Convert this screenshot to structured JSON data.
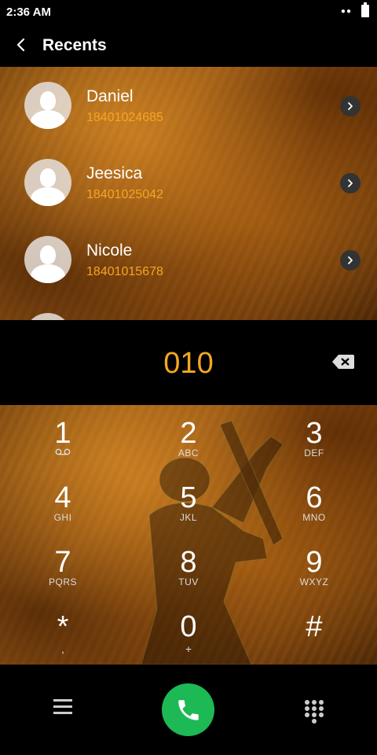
{
  "status_bar": {
    "time": "2:36 AM"
  },
  "header": {
    "title": "Recents"
  },
  "recents": [
    {
      "name": "Daniel",
      "number": "18401024685"
    },
    {
      "name": "Jeesica",
      "number": "18401025042"
    },
    {
      "name": "Nicole",
      "number": "18401015678"
    }
  ],
  "dialer": {
    "entered_number": "010",
    "accent_color": "#f5a623",
    "call_color": "#1db954"
  },
  "keypad": [
    {
      "digit": "1",
      "letters": ""
    },
    {
      "digit": "2",
      "letters": "ABC"
    },
    {
      "digit": "3",
      "letters": "DEF"
    },
    {
      "digit": "4",
      "letters": "GHI"
    },
    {
      "digit": "5",
      "letters": "JKL"
    },
    {
      "digit": "6",
      "letters": "MNO"
    },
    {
      "digit": "7",
      "letters": "PQRS"
    },
    {
      "digit": "8",
      "letters": "TUV"
    },
    {
      "digit": "9",
      "letters": "WXYZ"
    },
    {
      "digit": "*",
      "letters": ","
    },
    {
      "digit": "0",
      "letters": "+"
    },
    {
      "digit": "#",
      "letters": ""
    }
  ]
}
